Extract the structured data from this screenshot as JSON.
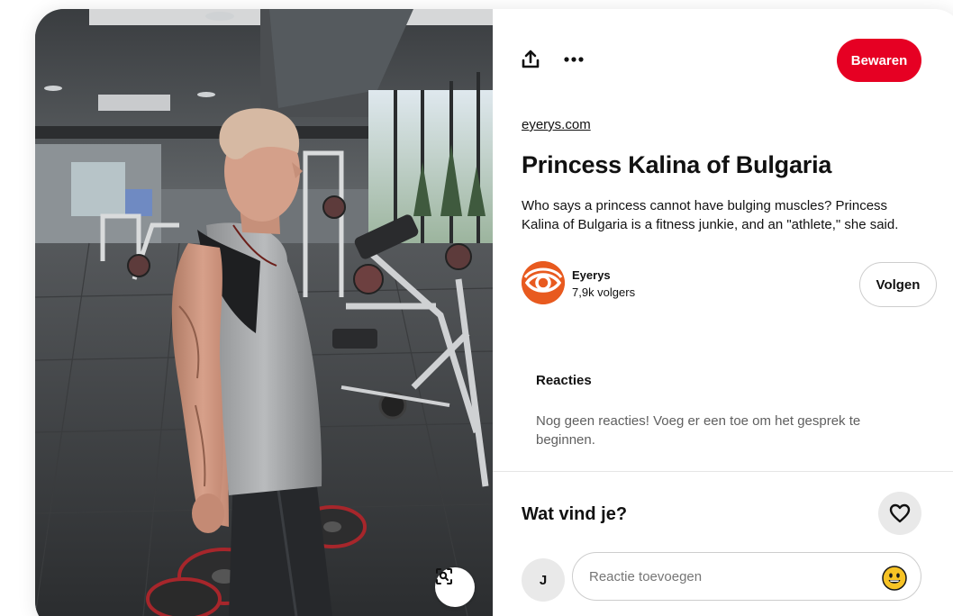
{
  "pin": {
    "source": "eyerys.com",
    "title": "Princess Kalina of Bulgaria",
    "description": "Who says a princess cannot have bulging muscles? Princess Kalina of Bulgaria is a fitness junkie, and an \"athlete,\" she said."
  },
  "toolbar": {
    "share_icon": "share-icon",
    "more_icon": "more-dots-icon",
    "save_label": "Bewaren"
  },
  "creator": {
    "name": "Eyerys",
    "followers": "7,9k volgers",
    "follow_label": "Volgen"
  },
  "comments": {
    "heading": "Reacties",
    "empty_text": "Nog geen reacties! Voeg er een toe om het gesprek te beginnen."
  },
  "feedback": {
    "question": "Wat vind je?",
    "like_icon": "heart-icon"
  },
  "composer": {
    "user_initial": "J",
    "placeholder": "Reactie toevoegen",
    "emoji_icon": "smiley-emoji-icon"
  },
  "colors": {
    "brand_red": "#e60023",
    "eyerys_orange": "#e85a1f"
  }
}
